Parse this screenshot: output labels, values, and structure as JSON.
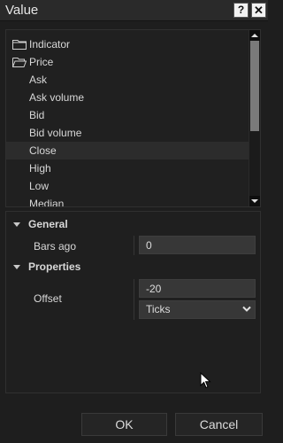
{
  "window": {
    "title": "Value",
    "help_label": "?",
    "close_label": "✕"
  },
  "tree": {
    "folders": [
      {
        "label": "Indicator",
        "icon": "folder-icon"
      },
      {
        "label": "Price",
        "icon": "folder-open-icon"
      }
    ],
    "items": [
      {
        "label": "Ask"
      },
      {
        "label": "Ask volume"
      },
      {
        "label": "Bid"
      },
      {
        "label": "Bid volume"
      },
      {
        "label": "Close",
        "selected": true
      },
      {
        "label": "High"
      },
      {
        "label": "Low"
      },
      {
        "label": "Median"
      }
    ]
  },
  "properties": {
    "general": {
      "label": "General",
      "bars_ago_label": "Bars ago",
      "bars_ago_value": "0"
    },
    "props": {
      "label": "Properties",
      "offset_label": "Offset",
      "offset_value": "-20",
      "offset_type": "Ticks"
    }
  },
  "buttons": {
    "ok": "OK",
    "cancel": "Cancel"
  },
  "colors": {
    "background": "#1e1e1e",
    "field": "#373737",
    "text": "#d8d8d8",
    "selected_row": "#2c2c2c",
    "scroll_thumb": "#7a7a7a"
  }
}
